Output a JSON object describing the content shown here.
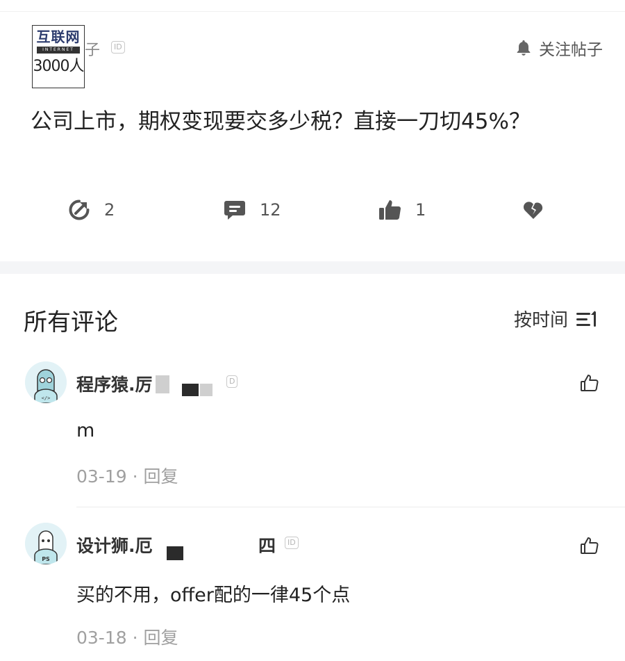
{
  "watermark": {
    "line1": "互联网",
    "line2": "INTERNET",
    "line3": "3000人"
  },
  "post": {
    "author_visible": "子",
    "id_badge": "ID",
    "follow_label": "关注帖子",
    "title": "公司上市，期权变现要交多少税？直接一刀切45%？",
    "stats": {
      "share_count": "2",
      "comment_count": "12",
      "like_count": "1"
    }
  },
  "comments_section": {
    "title": "所有评论",
    "sort_label": "按时间"
  },
  "comments": [
    {
      "name": "程序猿.厉",
      "id_badge": "D",
      "text": "m",
      "date": "03-19",
      "reply_label": "回复",
      "avatar": "programmer-avatar-icon"
    },
    {
      "name": "设计狮.厄",
      "name_suffix": "四",
      "id_badge": "ID",
      "text": "买的不用，offer配的一律45个点",
      "date": "03-18",
      "reply_label": "回复",
      "avatar": "designer-avatar-icon"
    }
  ],
  "colors": {
    "text": "#222222",
    "muted": "#a0a0a0",
    "icon": "#555555",
    "avatar_bg": "#e2f2f6",
    "band": "#f4f5f7"
  }
}
